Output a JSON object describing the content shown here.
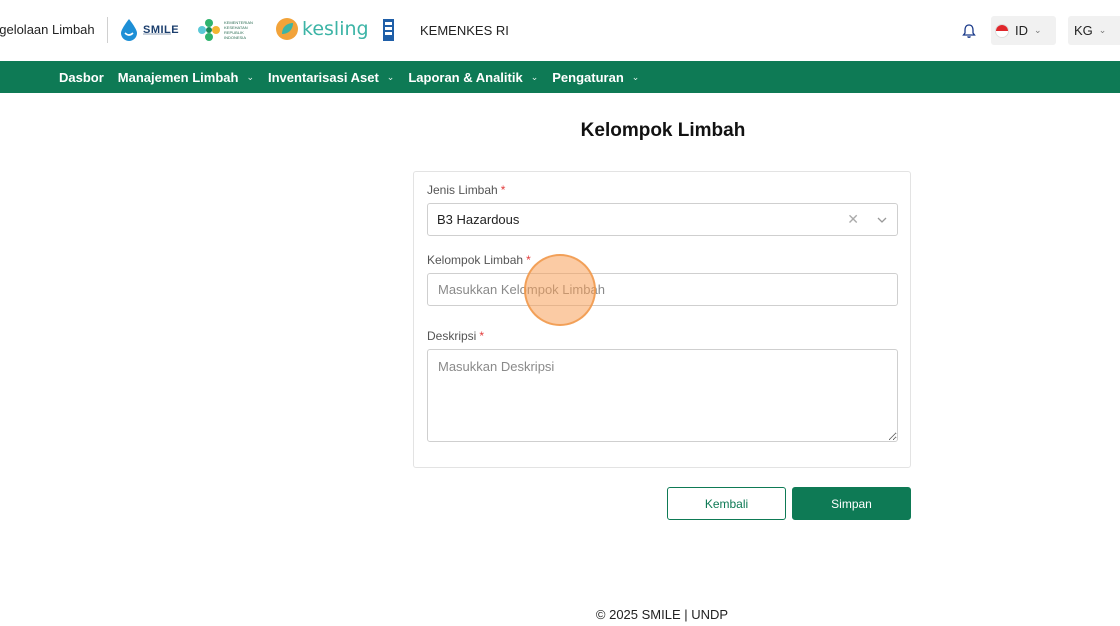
{
  "header": {
    "app_title": "ngelolaan Limbah",
    "logos": {
      "smile": "SMILE",
      "kemkes": "KEMENTERIAN KESEHATAN REPUBLIK INDONESIA",
      "kesling": "kesling"
    },
    "org_name": "KEMENKES RI",
    "notification_icon": "bell-icon",
    "language": "ID",
    "user_initials": "KG"
  },
  "nav": {
    "items": [
      {
        "label": "Dasbor",
        "has_dropdown": false
      },
      {
        "label": "Manajemen Limbah",
        "has_dropdown": true
      },
      {
        "label": "Inventarisasi Aset",
        "has_dropdown": true
      },
      {
        "label": "Laporan & Analitik",
        "has_dropdown": true
      },
      {
        "label": "Pengaturan",
        "has_dropdown": true
      }
    ]
  },
  "page": {
    "title": "Kelompok Limbah"
  },
  "form": {
    "jenis_limbah": {
      "label": "Jenis Limbah",
      "required_mark": "*",
      "value": "B3 Hazardous"
    },
    "kelompok_limbah": {
      "label": "Kelompok Limbah",
      "required_mark": "*",
      "value": "",
      "placeholder": "Masukkan Kelompok Limbah"
    },
    "deskripsi": {
      "label": "Deskripsi",
      "required_mark": "*",
      "value": "",
      "placeholder": "Masukkan Deskripsi"
    }
  },
  "actions": {
    "back_label": "Kembali",
    "save_label": "Simpan"
  },
  "footer": {
    "text": "© 2025 SMILE | UNDP"
  },
  "colors": {
    "primary": "#0e7a55",
    "required": "#e23b3b"
  }
}
